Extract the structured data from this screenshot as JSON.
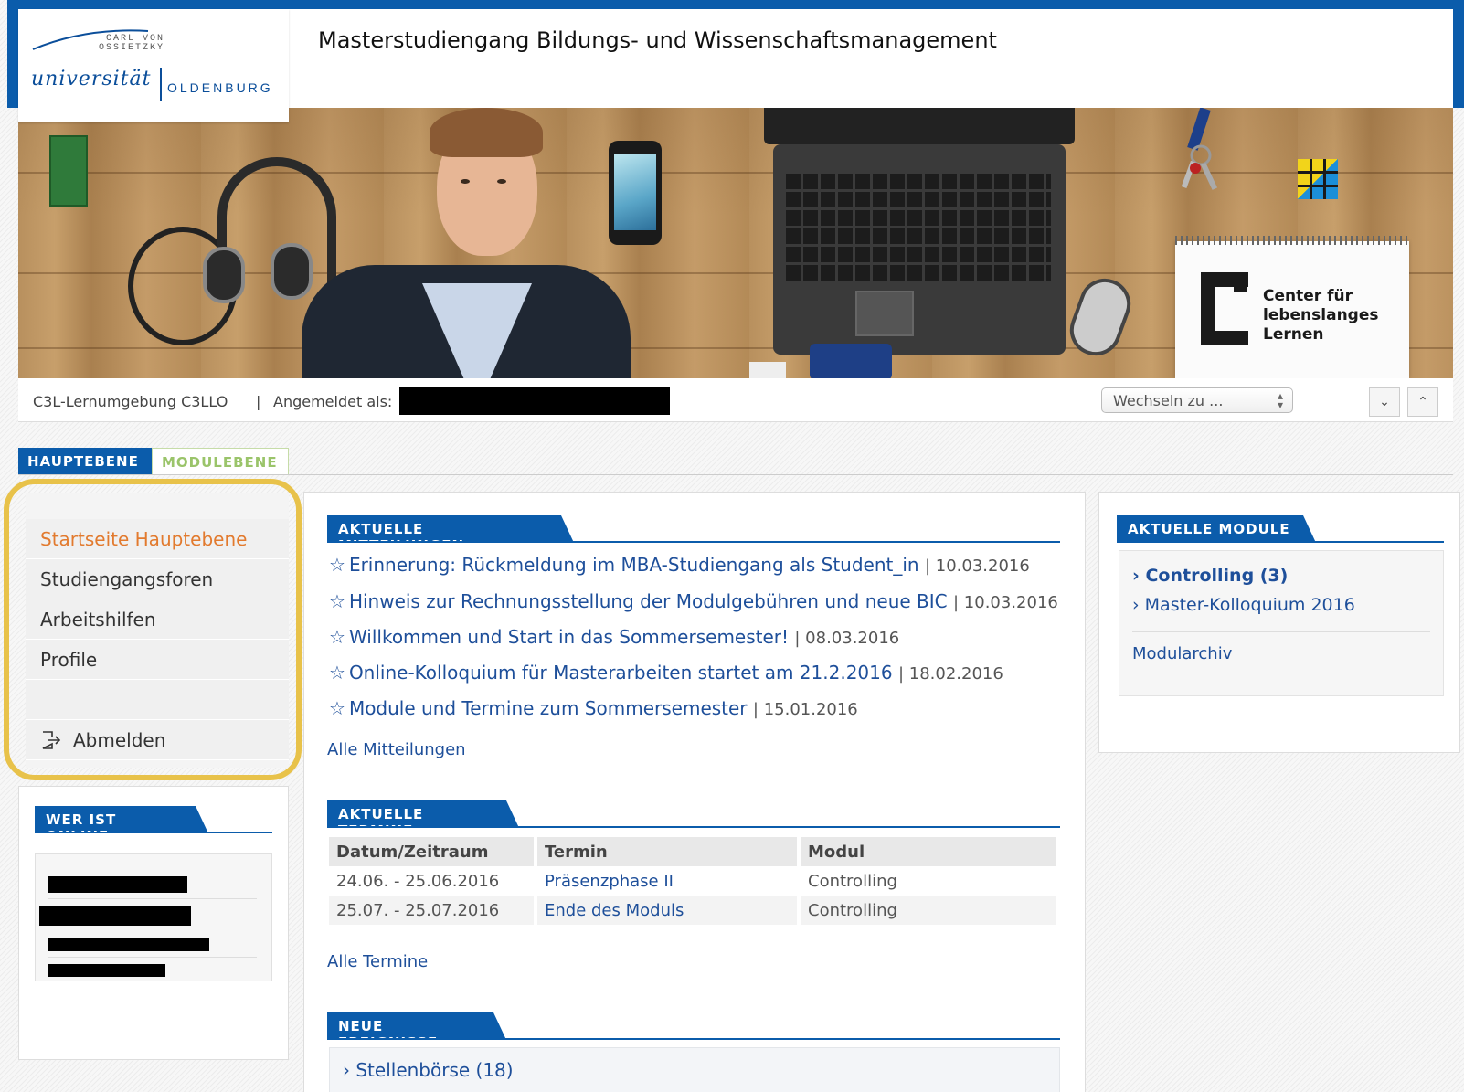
{
  "header": {
    "logo": {
      "carl_von_ossietzky": "CARL VON OSSIETZKY",
      "universitaet": "universität",
      "oldenburg": "OLDENBURG"
    },
    "site_title": "Masterstudiengang Bildungs- und Wissenschaftsmanagement"
  },
  "banner": {
    "logo_text_line1": "Center für",
    "logo_text_line2": "lebenslanges",
    "logo_text_line3": "Lernen"
  },
  "infobar": {
    "environment": "C3L-Lernumgebung C3LLO",
    "separator": "|",
    "logged_in_label": "Angemeldet als:",
    "switch_label": "Wechseln zu ...",
    "down_glyph": "⌄",
    "up_glyph": "⌃"
  },
  "tabs": {
    "main": "HAUPTEBENE",
    "module": "MODULEBENE"
  },
  "sidenav": {
    "items": [
      {
        "label": "Startseite Hauptebene",
        "active": true
      },
      {
        "label": "Studiengangsforen",
        "active": false
      },
      {
        "label": "Arbeitshilfen",
        "active": false
      },
      {
        "label": "Profile",
        "active": false
      }
    ],
    "logout": "Abmelden",
    "logout_icon": "logout-icon"
  },
  "online": {
    "title": "WER IST ONLINE"
  },
  "news": {
    "title": "AKTUELLE MITTEILUNGEN",
    "items": [
      {
        "text": "Erinnerung: Rückmeldung im MBA-Studiengang als Student_in",
        "date": "| 10.03.2016"
      },
      {
        "text": "Hinweis zur Rechnungsstellung der Modulgebühren und neue BIC",
        "date": "| 10.03.2016"
      },
      {
        "text": "Willkommen und Start in das Sommersemester!",
        "date": "| 08.03.2016"
      },
      {
        "text": "Online-Kolloquium für Masterarbeiten startet am 21.2.2016",
        "date": "| 18.02.2016"
      },
      {
        "text": "Module und Termine zum Sommersemester",
        "date": "| 15.01.2016"
      }
    ],
    "all_link": "Alle Mitteilungen",
    "star_glyph": "☆"
  },
  "terms": {
    "title": "AKTUELLE TERMINE",
    "columns": [
      "Datum/Zeitraum",
      "Termin",
      "Modul"
    ],
    "rows": [
      [
        "24.06. - 25.06.2016",
        "Präsenzphase II",
        "Controlling"
      ],
      [
        "25.07. - 25.07.2016",
        "Ende des Moduls",
        "Controlling"
      ]
    ],
    "all_link": "Alle Termine"
  },
  "events": {
    "title": "NEUE EREIGNISSE",
    "item": "Stellenbörse (18)",
    "chevron": "›"
  },
  "modules": {
    "title": "AKTUELLE MODULE",
    "items": [
      {
        "label": "Controlling (3)",
        "bold": true
      },
      {
        "label": "Master-Kolloquium 2016",
        "bold": false
      }
    ],
    "archive": "Modularchiv",
    "chevron": "›"
  },
  "colors": {
    "brand_blue": "#0b5cab",
    "link_blue": "#1e4f9a",
    "active_orange": "#e27a2e",
    "highlight_yellow": "#e8c24a",
    "module_green": "#9ac46a"
  }
}
